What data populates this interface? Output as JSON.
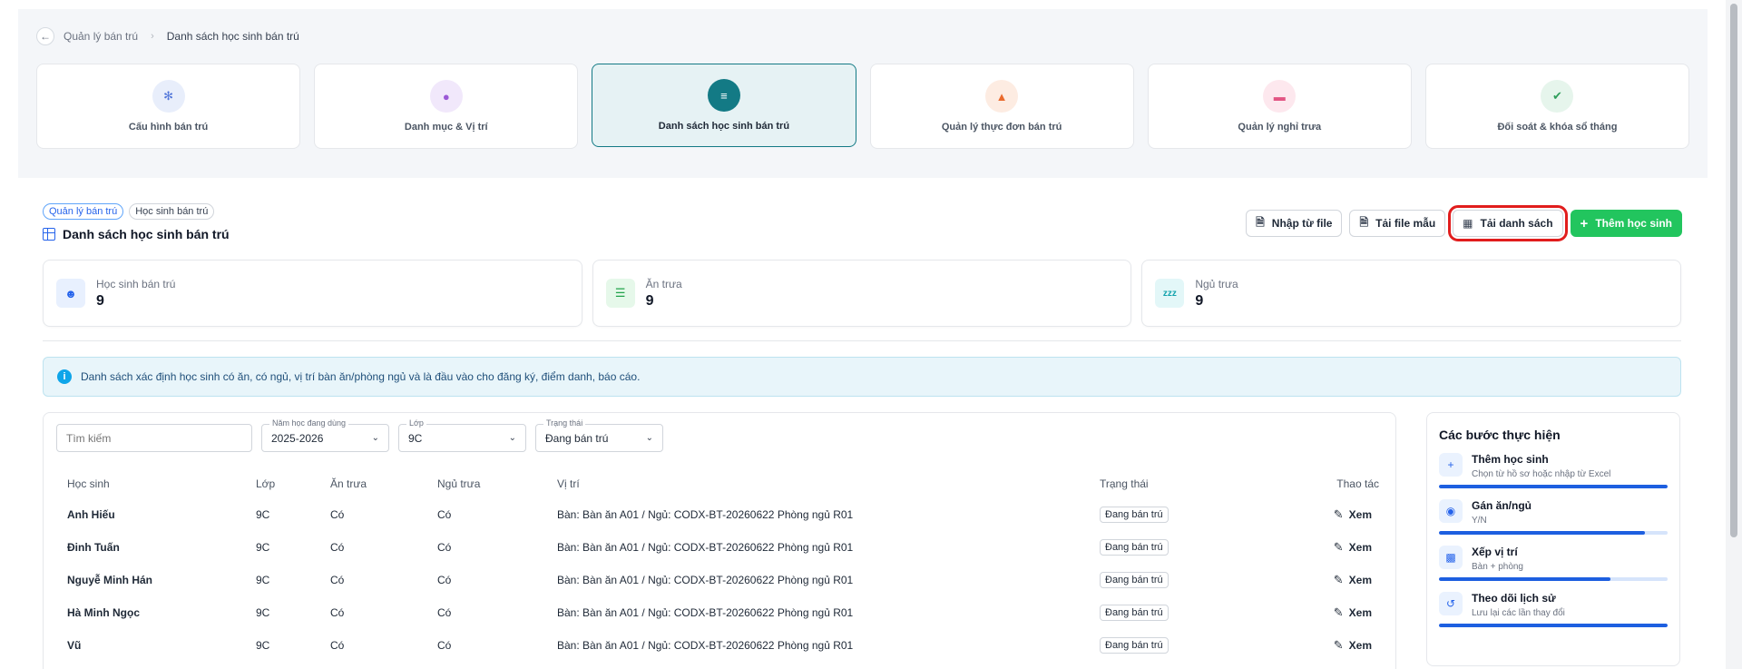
{
  "breadcrumb": {
    "parent": "Quản lý bán trú",
    "current": "Danh sách học sinh bán trú"
  },
  "modules": [
    {
      "label": "Cấu hình bán trú",
      "icon": "gear-icon",
      "bg": "#e8eefb",
      "fg": "#4f74d9"
    },
    {
      "label": "Danh mục & Vị trí",
      "icon": "location-pin-icon",
      "bg": "#f1e8fb",
      "fg": "#9b59d6"
    },
    {
      "label": "Danh sách học sinh bán trú",
      "icon": "list-icon",
      "bg": "#137a85",
      "fg": "#ffffff",
      "active": true
    },
    {
      "label": "Quản lý thực đơn bán trú",
      "icon": "menu-icon",
      "bg": "#fdece2",
      "fg": "#ea6a2c"
    },
    {
      "label": "Quản lý nghỉ trưa",
      "icon": "bed-icon",
      "bg": "#fde8ee",
      "fg": "#e25583"
    },
    {
      "label": "Đối soát & khóa sổ tháng",
      "icon": "check-icon",
      "bg": "#e6f5ec",
      "fg": "#2f9e5b"
    }
  ],
  "tags": {
    "primary": "Quản lý bán trú",
    "secondary": "Học sinh bán trú"
  },
  "list_title": "Danh sách học sinh bán trú",
  "actions": {
    "import": "Nhập từ file",
    "template": "Tải file mẫu",
    "download": "Tải danh sách",
    "add": "Thêm học sinh"
  },
  "stats": [
    {
      "label": "Học sinh bán trú",
      "value": "9",
      "icon": "student-icon",
      "bg": "#e8f0fe",
      "fg": "#2563eb"
    },
    {
      "label": "Ăn trưa",
      "value": "9",
      "icon": "meal-icon",
      "bg": "#e6f8ea",
      "fg": "#22a34a"
    },
    {
      "label": "Ngủ trưa",
      "value": "9",
      "icon": "sleep-icon",
      "bg": "#e3f7f8",
      "fg": "#14a3ad"
    }
  ],
  "info_text": "Danh sách xác định học sinh có ăn, có ngủ, vị trí bàn ăn/phòng ngủ và là đầu vào cho đăng ký, điểm danh, báo cáo.",
  "filters": {
    "search_placeholder": "Tìm kiếm",
    "year_label": "Năm học đang dùng",
    "year_value": "2025-2026",
    "class_label": "Lớp",
    "class_value": "9C",
    "status_label": "Trạng thái",
    "status_value": "Đang bán trú"
  },
  "table": {
    "headers": {
      "student": "Học sinh",
      "class": "Lớp",
      "lunch": "Ăn trưa",
      "nap": "Ngủ trưa",
      "position": "Vị trí",
      "status": "Trạng thái",
      "actions": "Thao tác"
    },
    "rows": [
      {
        "name": "Anh Hiếu",
        "class": "9C",
        "lunch": "Có",
        "nap": "Có",
        "position": "Bàn: Bàn ăn A01 / Ngủ: CODX-BT-20260622 Phòng ngủ R01",
        "status": "Đang bán trú",
        "action": "Xem"
      },
      {
        "name": "Đinh Tuấn",
        "class": "9C",
        "lunch": "Có",
        "nap": "Có",
        "position": "Bàn: Bàn ăn A01 / Ngủ: CODX-BT-20260622 Phòng ngủ R01",
        "status": "Đang bán trú",
        "action": "Xem"
      },
      {
        "name": "Nguyễ Minh Hán",
        "class": "9C",
        "lunch": "Có",
        "nap": "Có",
        "position": "Bàn: Bàn ăn A01 / Ngủ: CODX-BT-20260622 Phòng ngủ R01",
        "status": "Đang bán trú",
        "action": "Xem"
      },
      {
        "name": "Hà Minh Ngọc",
        "class": "9C",
        "lunch": "Có",
        "nap": "Có",
        "position": "Bàn: Bàn ăn A01 / Ngủ: CODX-BT-20260622 Phòng ngủ R01",
        "status": "Đang bán trú",
        "action": "Xem"
      },
      {
        "name": "Vũ",
        "class": "9C",
        "lunch": "Có",
        "nap": "Có",
        "position": "Bàn: Bàn ăn A01 / Ngủ: CODX-BT-20260622 Phòng ngủ R01",
        "status": "Đang bán trú",
        "action": "Xem"
      }
    ]
  },
  "steps": {
    "title": "Các bước thực hiện",
    "items": [
      {
        "title": "Thêm học sinh",
        "sub": "Chọn từ hồ sơ hoặc nhập từ Excel",
        "icon": "add-user-icon",
        "progress": 1.0
      },
      {
        "title": "Gán ăn/ngủ",
        "sub": "Y/N",
        "icon": "toggle-icon",
        "progress": 0.9
      },
      {
        "title": "Xếp vị trí",
        "sub": "Bàn + phòng",
        "icon": "seat-icon",
        "progress": 0.75
      },
      {
        "title": "Theo dõi lịch sử",
        "sub": "Lưu lại các lần thay đổi",
        "icon": "history-icon",
        "progress": 1.0
      }
    ]
  }
}
